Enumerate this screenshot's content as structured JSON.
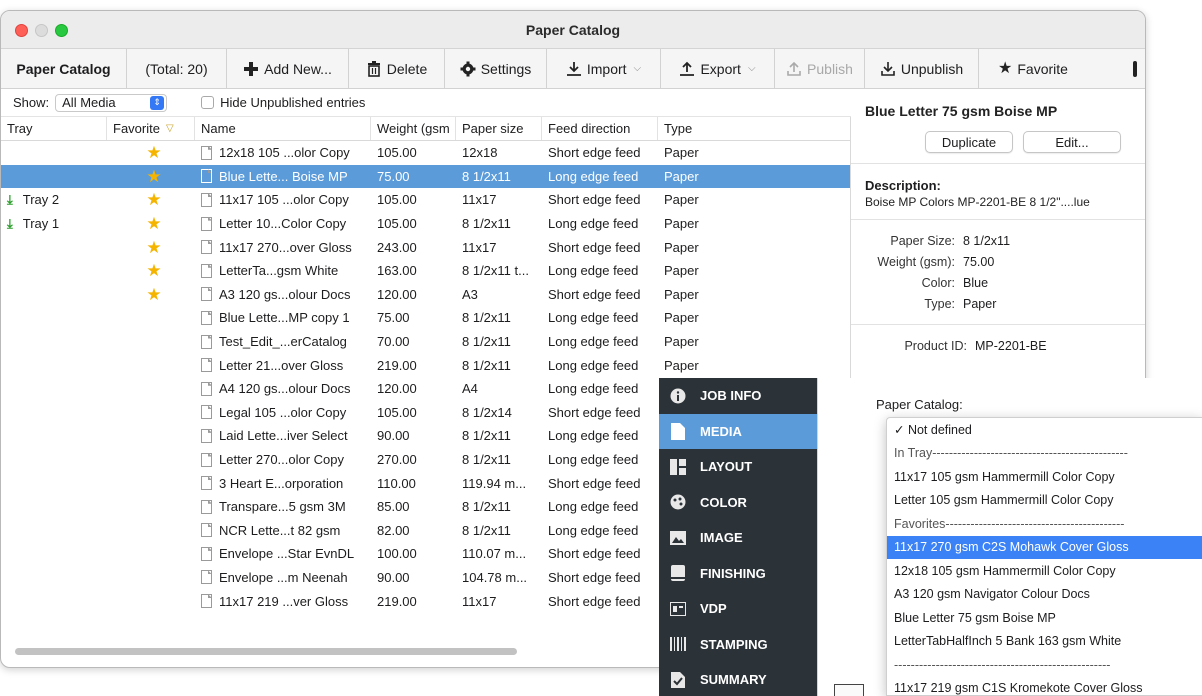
{
  "window": {
    "title": "Paper Catalog"
  },
  "toolbar": {
    "catalog_label": "Paper Catalog",
    "total": "(Total: 20)",
    "add_new": "Add New...",
    "delete": "Delete",
    "settings": "Settings",
    "import": "Import",
    "export": "Export",
    "publish": "Publish",
    "unpublish": "Unpublish",
    "favorite": "Favorite"
  },
  "filter": {
    "show_label": "Show:",
    "show_value": "All Media",
    "hide_unpublished": "Hide Unpublished entries"
  },
  "table": {
    "columns": [
      "Tray",
      "Favorite",
      "Name",
      "Weight (gsm",
      "Paper size",
      "Feed direction",
      "Type"
    ],
    "rows": [
      {
        "tray": "",
        "fav": true,
        "name": "12x18 105 ...olor Copy",
        "weight": "105.00",
        "size": "12x18",
        "feed": "Short edge feed",
        "type": "Paper"
      },
      {
        "tray": "",
        "fav": true,
        "name": "Blue Lette... Boise MP",
        "weight": "75.00",
        "size": "8 1/2x11",
        "feed": "Long edge feed",
        "type": "Paper",
        "selected": true
      },
      {
        "tray": "Tray 2",
        "fav": true,
        "name": "11x17 105 ...olor Copy",
        "weight": "105.00",
        "size": "11x17",
        "feed": "Short edge feed",
        "type": "Paper"
      },
      {
        "tray": "Tray 1",
        "fav": true,
        "name": "Letter 10...Color Copy",
        "weight": "105.00",
        "size": "8 1/2x11",
        "feed": "Long edge feed",
        "type": "Paper"
      },
      {
        "tray": "",
        "fav": true,
        "name": "11x17 270...over Gloss",
        "weight": "243.00",
        "size": "11x17",
        "feed": "Short edge feed",
        "type": "Paper"
      },
      {
        "tray": "",
        "fav": true,
        "name": "LetterTa...gsm White",
        "weight": "163.00",
        "size": "8 1/2x11 t...",
        "feed": "Long edge feed",
        "type": "Paper"
      },
      {
        "tray": "",
        "fav": true,
        "name": "A3 120 gs...olour Docs",
        "weight": "120.00",
        "size": "A3",
        "feed": "Short edge feed",
        "type": "Paper"
      },
      {
        "tray": "",
        "fav": false,
        "name": "Blue Lette...MP copy 1",
        "weight": "75.00",
        "size": "8 1/2x11",
        "feed": "Long edge feed",
        "type": "Paper"
      },
      {
        "tray": "",
        "fav": false,
        "name": "Test_Edit_...erCatalog",
        "weight": "70.00",
        "size": "8 1/2x11",
        "feed": "Long edge feed",
        "type": "Paper"
      },
      {
        "tray": "",
        "fav": false,
        "name": "Letter 21...over Gloss",
        "weight": "219.00",
        "size": "8 1/2x11",
        "feed": "Long edge feed",
        "type": "Paper"
      },
      {
        "tray": "",
        "fav": false,
        "name": "A4 120 gs...olour Docs",
        "weight": "120.00",
        "size": "A4",
        "feed": "Long edge feed",
        "type": "Paper"
      },
      {
        "tray": "",
        "fav": false,
        "name": "Legal 105 ...olor Copy",
        "weight": "105.00",
        "size": "8 1/2x14",
        "feed": "Short edge feed",
        "type": "Paper"
      },
      {
        "tray": "",
        "fav": false,
        "name": "Laid Lette...iver Select",
        "weight": "90.00",
        "size": "8 1/2x11",
        "feed": "Long edge feed",
        "type": "Paper"
      },
      {
        "tray": "",
        "fav": false,
        "name": "Letter 270...olor Copy",
        "weight": "270.00",
        "size": "8 1/2x11",
        "feed": "Long edge feed",
        "type": "Paper"
      },
      {
        "tray": "",
        "fav": false,
        "name": "3 Heart E...orporation",
        "weight": "110.00",
        "size": "119.94 m...",
        "feed": "Short edge feed",
        "type": "Paper"
      },
      {
        "tray": "",
        "fav": false,
        "name": "Transpare...5 gsm 3M",
        "weight": "85.00",
        "size": "8 1/2x11",
        "feed": "Long edge feed",
        "type": "Paper"
      },
      {
        "tray": "",
        "fav": false,
        "name": "NCR Lette...t 82 gsm",
        "weight": "82.00",
        "size": "8 1/2x11",
        "feed": "Long edge feed",
        "type": "Paper"
      },
      {
        "tray": "",
        "fav": false,
        "name": "Envelope ...Star EvnDL",
        "weight": "100.00",
        "size": "110.07 m...",
        "feed": "Short edge feed",
        "type": "Paper"
      },
      {
        "tray": "",
        "fav": false,
        "name": "Envelope ...m Neenah",
        "weight": "90.00",
        "size": "104.78 m...",
        "feed": "Short edge feed",
        "type": "Paper"
      },
      {
        "tray": "",
        "fav": false,
        "name": "11x17 219 ...ver Gloss",
        "weight": "219.00",
        "size": "11x17",
        "feed": "Short edge feed",
        "type": "Paper"
      }
    ]
  },
  "detail": {
    "title": "Blue Letter 75 gsm Boise MP",
    "duplicate": "Duplicate",
    "edit": "Edit...",
    "description_label": "Description:",
    "description_value": "Boise MP Colors MP-2201-BE 8 1/2\"....lue",
    "props": [
      {
        "k": "Paper Size:",
        "v": "8 1/2x11"
      },
      {
        "k": "Weight (gsm):",
        "v": "75.00"
      },
      {
        "k": "Color:",
        "v": "Blue"
      },
      {
        "k": "Type:",
        "v": "Paper"
      }
    ],
    "product_id_label": "Product ID:",
    "product_id": "MP-2201-BE"
  },
  "sidebar": {
    "items": [
      {
        "label": "JOB INFO",
        "icon": "info-icon"
      },
      {
        "label": "MEDIA",
        "icon": "media-icon",
        "active": true
      },
      {
        "label": "LAYOUT",
        "icon": "layout-icon"
      },
      {
        "label": "COLOR",
        "icon": "palette-icon"
      },
      {
        "label": "IMAGE",
        "icon": "image-icon"
      },
      {
        "label": "FINISHING",
        "icon": "finishing-icon"
      },
      {
        "label": "VDP",
        "icon": "vdp-icon"
      },
      {
        "label": "STAMPING",
        "icon": "stamping-icon"
      },
      {
        "label": "SUMMARY",
        "icon": "summary-icon"
      }
    ]
  },
  "media_panel": {
    "label": "Paper Catalog:",
    "menu": [
      {
        "text": "✓ Not defined"
      },
      {
        "text": "In Tray-----------------------------------------------",
        "sep": true
      },
      {
        "text": "11x17 105 gsm Hammermill Color Copy"
      },
      {
        "text": "Letter 105 gsm Hammermill Color Copy"
      },
      {
        "text": "Favorites-------------------------------------------",
        "sep": true
      },
      {
        "text": "11x17 270 gsm C2S Mohawk Cover Gloss",
        "highlight": true
      },
      {
        "text": "12x18 105 gsm Hammermill Color Copy"
      },
      {
        "text": "A3 120 gsm Navigator Colour Docs"
      },
      {
        "text": "Blue Letter 75 gsm Boise MP"
      },
      {
        "text": "LetterTabHalfInch 5 Bank 163 gsm White"
      },
      {
        "text": "----------------------------------------------------",
        "sep": true
      },
      {
        "text": "11x17 219 gsm C1S Kromekote Cover Gloss"
      }
    ]
  },
  "colors": {
    "selection": "#5b9bd9",
    "menu_highlight": "#3b82f6",
    "sidebar_bg": "#2b3238",
    "star": "#f4b400"
  }
}
